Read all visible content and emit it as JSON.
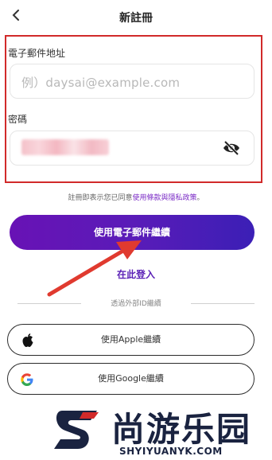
{
  "header": {
    "back_icon": "chevron-left-icon",
    "title": "新註冊"
  },
  "email": {
    "label": "電子郵件地址",
    "placeholder": "例）daysai@example.com"
  },
  "password": {
    "label": "密碼",
    "toggle_icon": "eye-off-icon"
  },
  "terms": {
    "prefix": "註冊即表示您已同意",
    "link_text": "使用條款與隱私政策",
    "suffix": "。"
  },
  "primary_button": {
    "label": "使用電子郵件繼續"
  },
  "login_link": {
    "label": "在此登入"
  },
  "divider": {
    "label": "透過外部ID繼續"
  },
  "social": [
    {
      "label": "使用Apple繼續",
      "icon": "apple-icon"
    },
    {
      "label": "使用Google繼續",
      "icon": "google-icon"
    }
  ],
  "watermark": {
    "brand": "尚游乐园",
    "url": "SHYIYUANYK.COM"
  },
  "colors": {
    "accent": "#5b21b6",
    "highlight": "#d12a2a",
    "arrow": "#e03a2f"
  }
}
